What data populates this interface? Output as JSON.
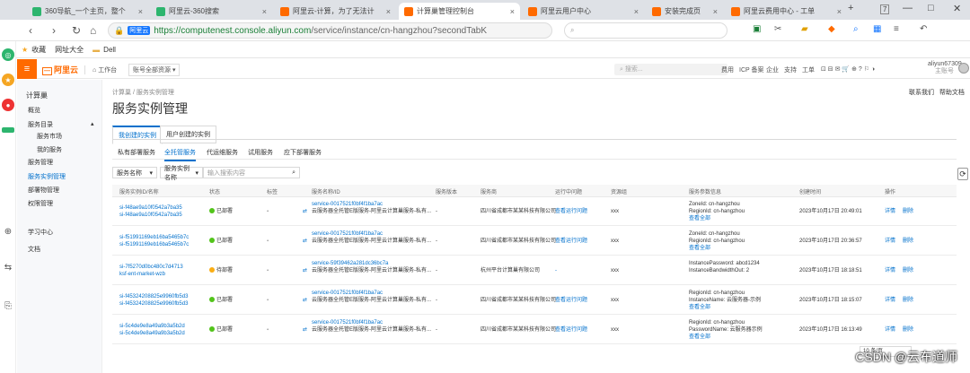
{
  "browser": {
    "tabs": [
      {
        "title": "360导航_一个主页，整个",
        "color": "#2db56e",
        "active": false
      },
      {
        "title": "阿里云-360搜索",
        "color": "#2db56e",
        "active": false
      },
      {
        "title": "阿里云-计算，为了无法计",
        "color": "#ff6a00",
        "active": false
      },
      {
        "title": "计算巢管理控制台",
        "color": "#ff6a00",
        "active": true
      },
      {
        "title": "阿里云用户中心",
        "color": "#ff6a00",
        "active": false
      },
      {
        "title": "安装完成页",
        "color": "#ff6a00",
        "active": false
      },
      {
        "title": "阿里云费用中心 - 工单",
        "color": "#ff6a00",
        "active": false
      }
    ],
    "window_buttons": {
      "new_tab": "+",
      "restore": "7",
      "minimize": "—",
      "maximize": "□",
      "close": "✕"
    },
    "url_badge": "阿里云",
    "url_host": "https://computenest.console.aliyun.com",
    "url_path": "/service/instance/cn-hangzhou?secondTabK",
    "search_placeholder": "",
    "bookmarks": [
      "收藏",
      "网址大全",
      "Dell"
    ]
  },
  "console": {
    "logo": "阿里云",
    "workbench": "工作台",
    "account_switch": "账号全部资源",
    "search_placeholder": "搜索...",
    "header_links": [
      "费用",
      "ICP 备案",
      "企业",
      "支持",
      "工单",
      "简体"
    ],
    "user": "aliyun67309...",
    "user_sub": "主账号"
  },
  "sidebar": {
    "title": "计算巢",
    "items": [
      {
        "label": "概览",
        "selected": false,
        "indent": 0
      },
      {
        "label": "服务目录",
        "selected": false,
        "indent": 0
      },
      {
        "label": "服务市场",
        "selected": false,
        "indent": 1
      },
      {
        "label": "我的服务",
        "selected": false,
        "indent": 1
      },
      {
        "label": "服务管理",
        "selected": false,
        "indent": 0
      },
      {
        "label": "服务实例管理",
        "selected": true,
        "indent": 0
      },
      {
        "label": "部署物管理",
        "selected": false,
        "indent": 0
      },
      {
        "label": "权限管理",
        "selected": false,
        "indent": 0
      },
      {
        "label": "学习中心",
        "selected": false,
        "indent": 0
      },
      {
        "label": "文档",
        "selected": false,
        "indent": 0
      }
    ]
  },
  "page": {
    "breadcrumb": "计算巢 / 服务实例管理",
    "title": "服务实例管理",
    "top_right": [
      "联系我们",
      "帮助文档"
    ],
    "main_tabs": [
      "我创建的实例",
      "用户创建的实例"
    ],
    "sub_tabs": [
      "私有部署服务",
      "全托管服务",
      "代运维服务",
      "试用服务",
      "应下部署服务"
    ],
    "filter_select": "服务名称",
    "filter_field": "服务实例名称",
    "filter_input_placeholder": "输入搜索内容",
    "refresh": "⟳",
    "pager": "10 条/页",
    "watermark": "CSDN @云布道师"
  },
  "table": {
    "columns": [
      "服务实例ID/名称",
      "状态",
      "标签",
      "服务名称/ID",
      "服务版本",
      "服务商",
      "运行中问题",
      "资源组",
      "服务参数信息",
      "创建时间",
      "操作"
    ],
    "rows": [
      {
        "id": "si-f48ae9a10f0542a7ba35",
        "name": "si-f48ae9a10f0542a7ba35",
        "status": "已部署",
        "status_color": "#52c41a",
        "service": "service-0017521f0bf4f1ba7ac",
        "service_name": "云服务器全托管E版服务-阿里云计算巢服务-私有...",
        "version": "-",
        "vendor": "四川省成都市某某科技有限公司",
        "issue": "查看运行问题",
        "resource": "xxx",
        "params": [
          "ZoneId: cn-hangzhou",
          "RegionId: cn-hangzhou",
          "查看全部"
        ],
        "created": "2023年10月17日 20:49:01",
        "ops": [
          "详情",
          "删除"
        ]
      },
      {
        "id": "si-f51991169eb16ba5465b7c",
        "name": "si-f51991169eb16ba5465b7c",
        "status": "已部署",
        "status_color": "#52c41a",
        "service": "service-0017521f0bf4f1ba7ac",
        "service_name": "云服务器全托管E版服务-阿里云计算巢服务-私有...",
        "version": "-",
        "vendor": "四川省成都市某某科技有限公司",
        "issue": "查看运行问题",
        "resource": "xxx",
        "params": [
          "ZoneId: cn-hangzhou",
          "RegionId: cn-hangzhou",
          "查看全部"
        ],
        "created": "2023年10月17日 20:36:57",
        "ops": [
          "详情",
          "删除"
        ]
      },
      {
        "id": "si-7f5270d0bc480c7d4713",
        "name": "ksf-ent-market-wzb",
        "status": "待部署",
        "status_color": "#faad14",
        "service": "service-59f39462a281dc36bc7a",
        "service_name": "云服务器全托管E版服务-阿里云计算巢服务-私有...",
        "version": "-",
        "vendor": "杭州平台计算巢有限公司",
        "issue": "-",
        "resource": "xxx",
        "params": [
          "InstancePassword: abcd1234",
          "InstanceBandwidthOut: 2"
        ],
        "created": "2023年10月17日 18:18:51",
        "ops": [
          "详情",
          "删除"
        ]
      },
      {
        "id": "si-f45324208825e9960fb5d3",
        "name": "si-f45324208825e9960fb5d3",
        "status": "已部署",
        "status_color": "#52c41a",
        "service": "service-0017521f0bf4f1ba7ac",
        "service_name": "云服务器全托管E版服务-阿里云计算巢服务-私有...",
        "version": "-",
        "vendor": "四川省成都市某某科技有限公司",
        "issue": "查看运行问题",
        "resource": "xxx",
        "params": [
          "RegionId: cn-hangzhou",
          "InstanceName: 云服务器-示例",
          "查看全部"
        ],
        "created": "2023年10月17日 18:15:07",
        "ops": [
          "详情",
          "删除"
        ]
      },
      {
        "id": "si-5c4de9e8a49a9b3a5b2d",
        "name": "si-5c4de9e8a49a9b3a5b2d",
        "status": "已部署",
        "status_color": "#52c41a",
        "service": "service-0017521f0bf4f1ba7ac",
        "service_name": "云服务器全托管E版服务-阿里云计算巢服务-私有...",
        "version": "-",
        "vendor": "四川省成都市某某科技有限公司",
        "issue": "查看运行问题",
        "resource": "xxx",
        "params": [
          "RegionId: cn-hangzhou",
          "PasswordName: 云服务器示例",
          "查看全部"
        ],
        "created": "2023年10月17日 16:13:49",
        "ops": [
          "详情",
          "删除"
        ]
      }
    ]
  }
}
